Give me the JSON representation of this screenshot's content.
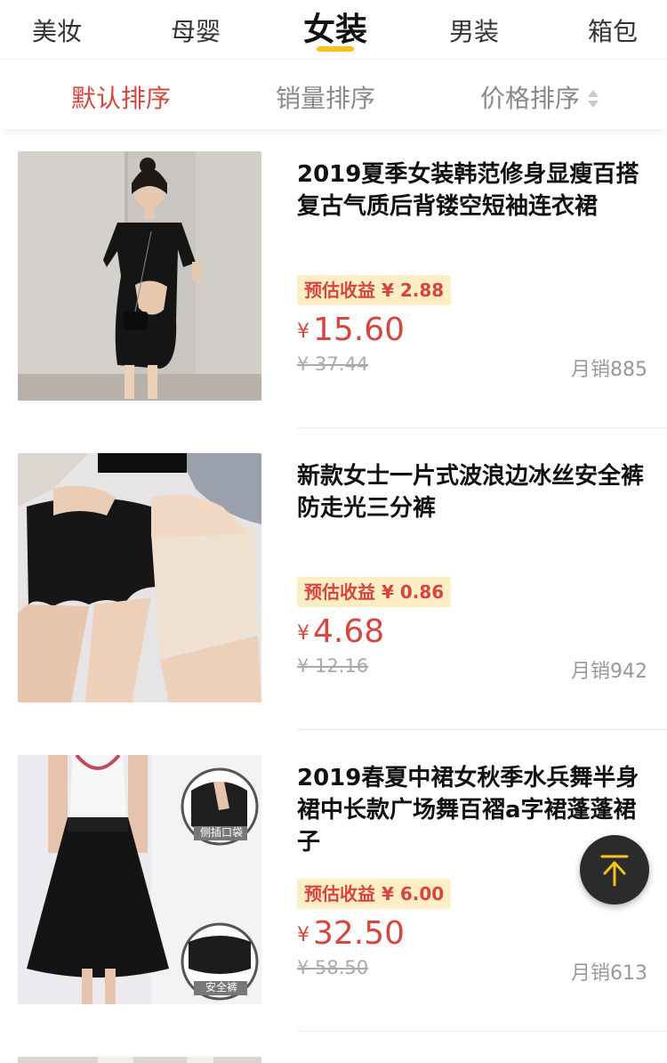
{
  "categories": [
    {
      "label": "美妆",
      "active": false
    },
    {
      "label": "母婴",
      "active": false
    },
    {
      "label": "女装",
      "active": true
    },
    {
      "label": "男装",
      "active": false
    },
    {
      "label": "箱包",
      "active": false
    }
  ],
  "sort": {
    "default": "默认排序",
    "sales": "销量排序",
    "price": "价格排序"
  },
  "currency_symbol": "¥",
  "products": [
    {
      "title": "2019夏季女装韩范修身显瘦百搭复古气质后背镂空短袖连衣裙",
      "earnings": "预估收益 ¥ 2.88",
      "price": "15.60",
      "original_price": "¥ 37.44",
      "monthly_sales": "月销885",
      "image_desc": "black-open-back-dress-photo"
    },
    {
      "title": "新款女士一片式波浪边冰丝安全裤防走光三分裤",
      "earnings": "预估收益 ¥ 0.86",
      "price": "4.68",
      "original_price": "¥ 12.16",
      "monthly_sales": "月销942",
      "image_desc": "safety-shorts-photo"
    },
    {
      "title": "2019春夏中裙女秋季水兵舞半身裙中长款广场舞百褶a字裙蓬蓬裙子",
      "earnings": "预估收益 ¥ 6.00",
      "price": "32.50",
      "original_price": "¥ 58.50",
      "monthly_sales": "月销613",
      "image_desc": "black-a-line-skirt-photo",
      "image_labels": [
        "侧插口袋",
        "安全裤"
      ]
    }
  ],
  "colors": {
    "accent_red": "#d6453e",
    "tab_underline": "#f7c21e",
    "badge_bg": "#fdeec6"
  },
  "back_to_top_icon": "arrow-up-to-top-icon"
}
